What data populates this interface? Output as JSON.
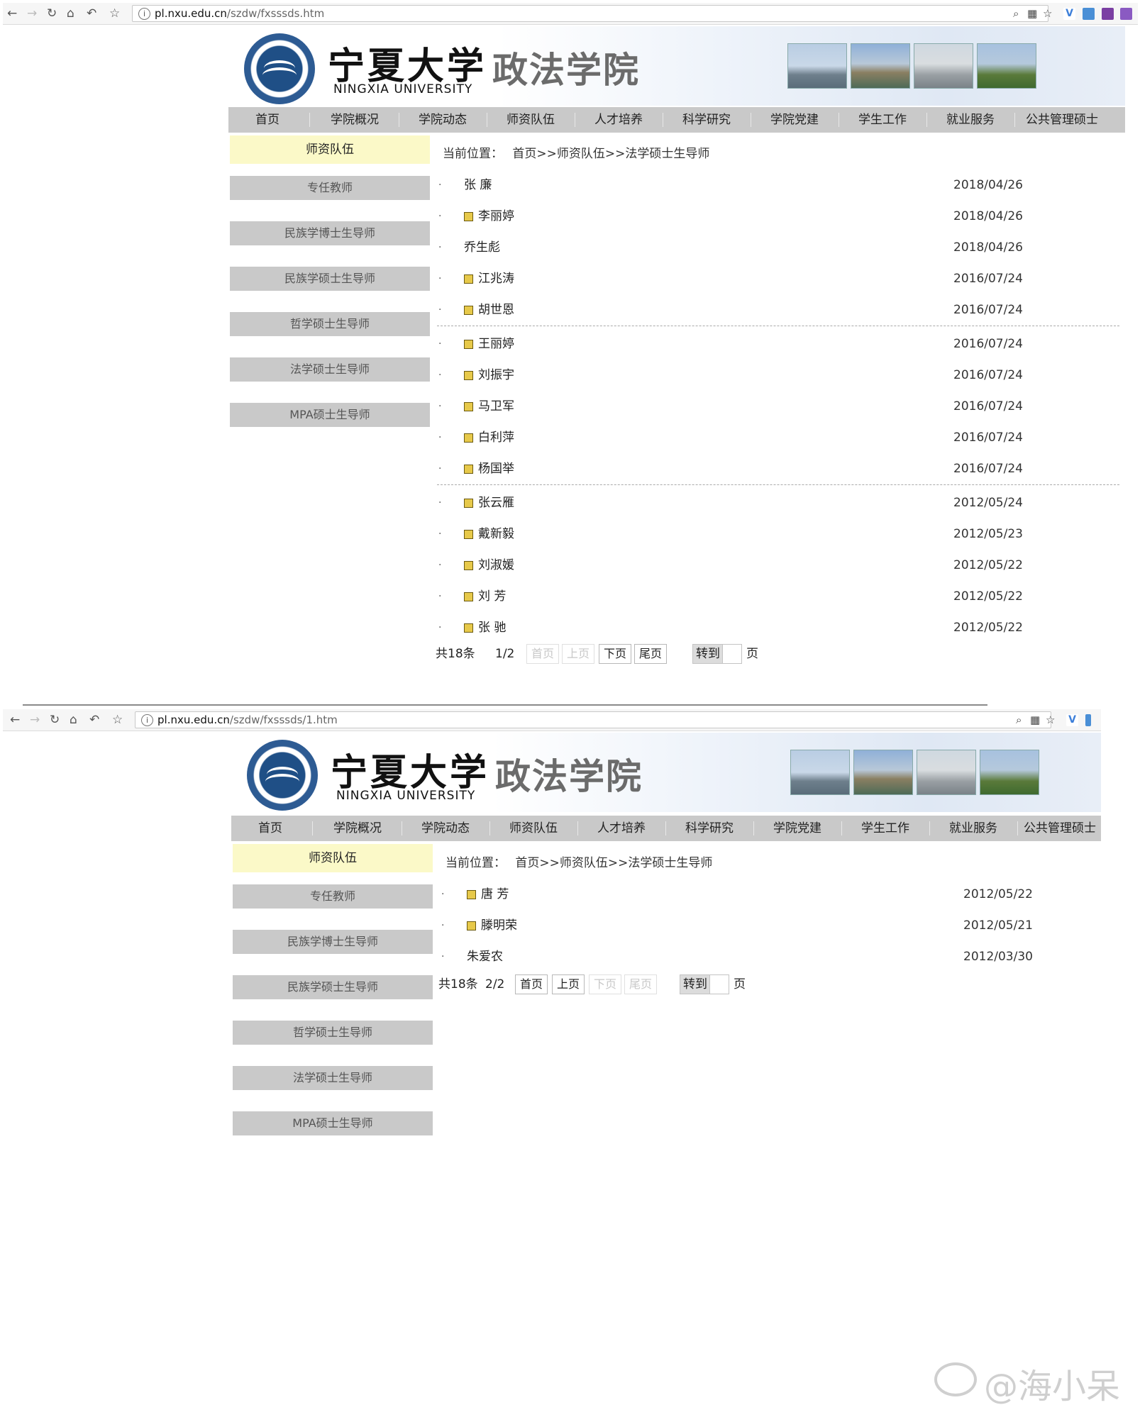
{
  "browser": {
    "shot1": {
      "url_host": "pl.nxu.edu.cn",
      "url_path": "/szdw/fxsssds.htm"
    },
    "shot2": {
      "url_host": "pl.nxu.edu.cn",
      "url_path": "/szdw/fxsssds/1.htm"
    },
    "nav_icons": [
      "back-icon",
      "forward-icon",
      "reload-icon",
      "home-icon",
      "undo-icon",
      "star-icon"
    ],
    "right_icons": [
      "zoom-icon",
      "qr-icon",
      "star-icon"
    ]
  },
  "header": {
    "cn_name": "宁夏大学",
    "en_name": "NINGXIA UNIVERSITY",
    "college": "政法学院"
  },
  "menu": [
    "首页",
    "学院概况",
    "学院动态",
    "师资队伍",
    "人才培养",
    "科学研究",
    "学院党建",
    "学生工作",
    "就业服务",
    "公共管理硕士"
  ],
  "sidebar": {
    "heading": "师资队伍",
    "items": [
      "专任教师",
      "民族学博士生导师",
      "民族学硕士生导师",
      "哲学硕士生导师",
      "法学硕士生导师",
      "MPA硕士生导师"
    ]
  },
  "breadcrumb": {
    "label": "当前位置：",
    "path": "首页>>师资队伍>>法学硕士生导师"
  },
  "page1": {
    "rows": [
      {
        "name": "张  廉",
        "date": "2018/04/26",
        "icon": false
      },
      {
        "name": "李丽婷",
        "date": "2018/04/26",
        "icon": true
      },
      {
        "name": "乔生彪",
        "date": "2018/04/26",
        "icon": false
      },
      {
        "name": "江兆涛",
        "date": "2016/07/24",
        "icon": true
      },
      {
        "name": "胡世恩",
        "date": "2016/07/24",
        "icon": true
      },
      {
        "name": "王丽婷",
        "date": "2016/07/24",
        "icon": true
      },
      {
        "name": "刘振宇",
        "date": "2016/07/24",
        "icon": true
      },
      {
        "name": "马卫军",
        "date": "2016/07/24",
        "icon": true
      },
      {
        "name": "白利萍",
        "date": "2016/07/24",
        "icon": true
      },
      {
        "name": "杨国举",
        "date": "2016/07/24",
        "icon": true
      },
      {
        "name": "张云雁",
        "date": "2012/05/24",
        "icon": true
      },
      {
        "name": "戴新毅",
        "date": "2012/05/23",
        "icon": true
      },
      {
        "name": "刘淑媛",
        "date": "2012/05/22",
        "icon": true
      },
      {
        "name": "刘  芳",
        "date": "2012/05/22",
        "icon": true
      },
      {
        "name": "张  驰",
        "date": "2012/05/22",
        "icon": true
      }
    ],
    "pager": {
      "total": "共18条",
      "page": "1/2",
      "first": "首页",
      "prev": "上页",
      "next": "下页",
      "last": "尾页",
      "goto": "转到",
      "unit": "页"
    }
  },
  "page2": {
    "rows": [
      {
        "name": "唐  芳",
        "date": "2012/05/22",
        "icon": true
      },
      {
        "name": "滕明荣",
        "date": "2012/05/21",
        "icon": true
      },
      {
        "name": "朱爱农",
        "date": "2012/03/30",
        "icon": false
      }
    ],
    "pager": {
      "total": "共18条",
      "page": "2/2",
      "first": "首页",
      "prev": "上页",
      "next": "下页",
      "last": "尾页",
      "goto": "转到",
      "unit": "页"
    }
  },
  "watermark": "@海小呆"
}
